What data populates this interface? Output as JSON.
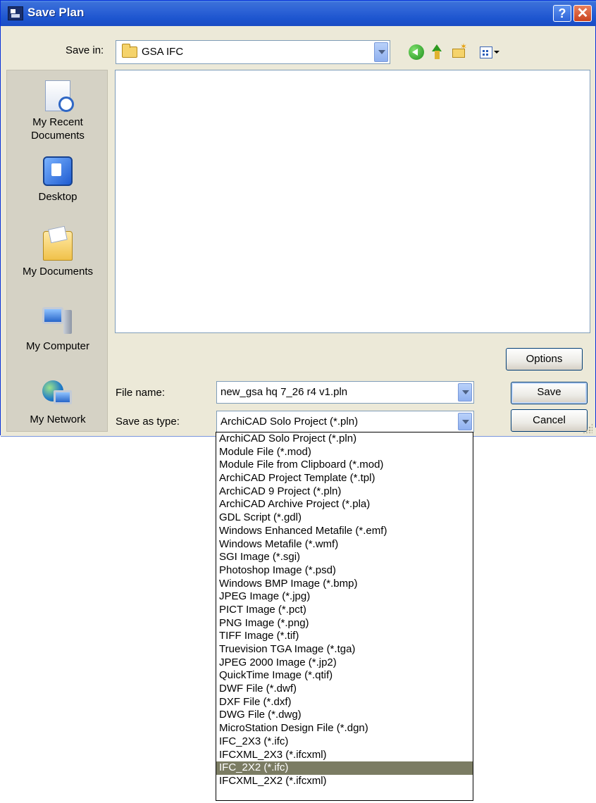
{
  "window": {
    "title": "Save Plan",
    "help_glyph": "?",
    "close_glyph": "✕"
  },
  "save_in": {
    "label": "Save in:",
    "value": "GSA IFC"
  },
  "places": [
    {
      "label_lines": [
        "My Recent",
        "Documents"
      ],
      "icon": "recent-documents-icon"
    },
    {
      "label_lines": [
        "Desktop"
      ],
      "icon": "desktop-icon"
    },
    {
      "label_lines": [
        "My Documents"
      ],
      "icon": "my-documents-icon"
    },
    {
      "label_lines": [
        "My Computer"
      ],
      "icon": "my-computer-icon"
    },
    {
      "label_lines": [
        "My Network"
      ],
      "icon": "my-network-icon"
    }
  ],
  "file_name": {
    "label": "File name:",
    "value": "new_gsa hq 7_26 r4 v1.pln"
  },
  "save_as_type": {
    "label": "Save as type:",
    "value": "ArchiCAD Solo Project (*.pln)",
    "options": [
      "ArchiCAD Solo Project (*.pln)",
      "Module File (*.mod)",
      "Module File from Clipboard (*.mod)",
      "ArchiCAD Project Template (*.tpl)",
      "ArchiCAD 9 Project (*.pln)",
      "ArchiCAD Archive Project (*.pla)",
      "GDL Script (*.gdl)",
      "Windows Enhanced Metafile (*.emf)",
      "Windows Metafile (*.wmf)",
      "SGI Image (*.sgi)",
      "Photoshop Image (*.psd)",
      "Windows BMP Image (*.bmp)",
      "JPEG Image (*.jpg)",
      "PICT Image (*.pct)",
      "PNG Image (*.png)",
      "TIFF Image (*.tif)",
      "Truevision TGA Image (*.tga)",
      "JPEG 2000 Image (*.jp2)",
      "QuickTime Image (*.qtif)",
      "DWF File (*.dwf)",
      "DXF File (*.dxf)",
      "DWG File (*.dwg)",
      "MicroStation Design File (*.dgn)",
      "IFC_2X3 (*.ifc)",
      "IFCXML_2X3 (*.ifcxml)",
      "IFC_2X2 (*.ifc)",
      "IFCXML_2X2 (*.ifcxml)"
    ],
    "highlighted_option": "IFC_2X2 (*.ifc)"
  },
  "buttons": {
    "options": "Options",
    "save": "Save",
    "cancel": "Cancel"
  },
  "colors": {
    "titlebar": "#1d55cf",
    "dialog_bg": "#ece9d8",
    "highlight": "#7b7c63"
  }
}
